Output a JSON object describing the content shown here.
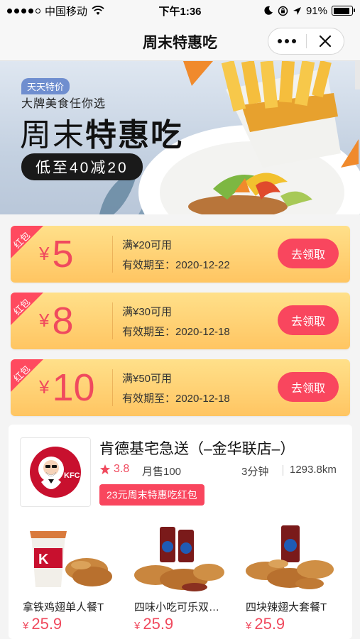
{
  "status_bar": {
    "carrier": "中国移动",
    "time": "下午1:36",
    "battery": "91%",
    "battery_level": 0.91
  },
  "nav": {
    "title": "周末特惠吃",
    "more_icon": "more-dots-icon",
    "close_icon": "close-icon"
  },
  "banner": {
    "tag": "天天特价",
    "subtitle": "大牌美食任你选",
    "title_light": "周末",
    "title_bold": "特惠吃",
    "pill": "低至40减20"
  },
  "coupons": [
    {
      "corner": "红包",
      "currency": "¥",
      "amount": "5",
      "condition": "满¥20可用",
      "expiry": "有效期至：2020-12-22",
      "button": "去领取"
    },
    {
      "corner": "红包",
      "currency": "¥",
      "amount": "8",
      "condition": "满¥30可用",
      "expiry": "有效期至：2020-12-18",
      "button": "去领取"
    },
    {
      "corner": "红包",
      "currency": "¥",
      "amount": "10",
      "condition": "满¥50可用",
      "expiry": "有效期至：2020-12-18",
      "button": "去领取"
    }
  ],
  "store": {
    "name": "肯德基宅急送（–金华联店–）",
    "rating": "3.8",
    "monthly_sales": "月售100",
    "eta": "3分钟",
    "distance": "1293.8km",
    "promo": "23元周末特惠吃红包",
    "logo_text": "KFC",
    "products": [
      {
        "name": "拿铁鸡翅单人餐T",
        "currency": "¥",
        "price": "25.9"
      },
      {
        "name": "四味小吃可乐双…",
        "currency": "¥",
        "price": "25.9"
      },
      {
        "name": "四块辣翅大套餐T",
        "currency": "¥",
        "price": "25.9"
      }
    ]
  },
  "colors": {
    "accent_red": "#f9465e",
    "coupon_yellow": "#ffc562",
    "banner_blue": "#c4d1e1"
  }
}
